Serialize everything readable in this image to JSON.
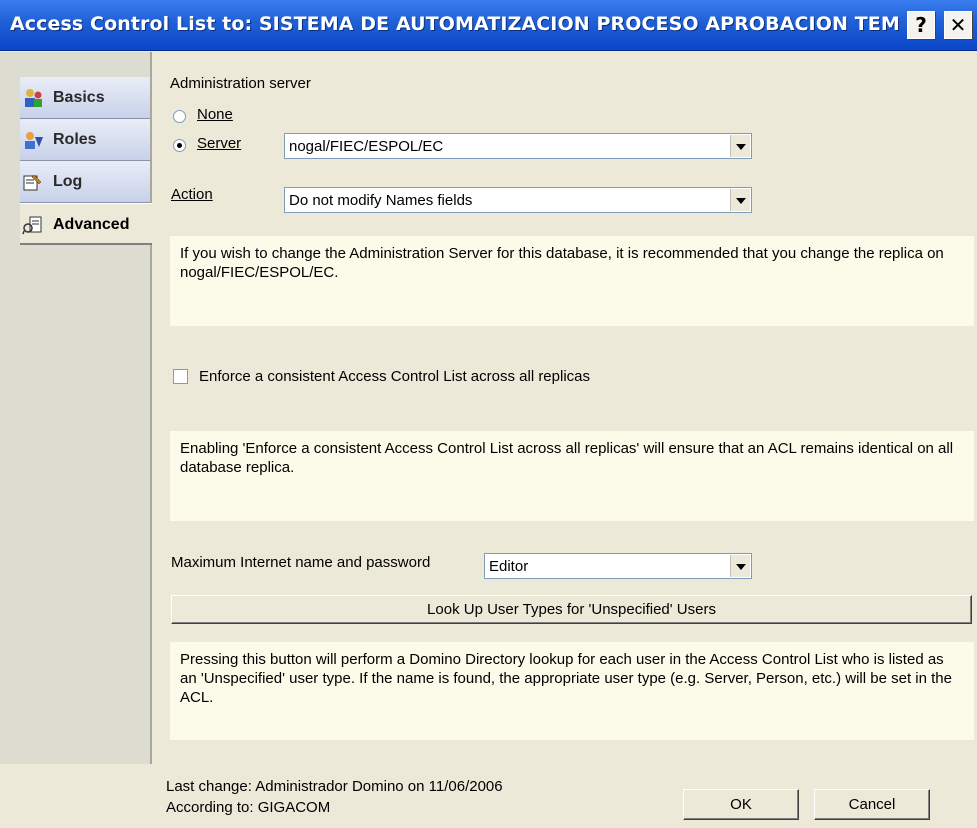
{
  "window": {
    "title": "Access Control List to: SISTEMA DE AUTOMATIZACION PROCESO APROBACION TEMAS DE TESIS",
    "help_label": "?",
    "close_label": "✕"
  },
  "sidebar": {
    "tabs": [
      {
        "label": "Basics",
        "icon": "people-icon"
      },
      {
        "label": "Roles",
        "icon": "roles-icon"
      },
      {
        "label": "Log",
        "icon": "log-icon"
      },
      {
        "label": "Advanced",
        "icon": "advanced-icon",
        "active": true
      }
    ]
  },
  "admin_server": {
    "heading": "Administration server",
    "option_none": "None",
    "option_server": "Server",
    "selected": "Server",
    "server_value": "nogal/FIEC/ESPOL/EC",
    "action_label": "Action",
    "action_value": "Do not modify Names fields",
    "info": "If you wish to change the Administration Server for this database, it is recommended that you change the replica on nogal/FIEC/ESPOL/EC."
  },
  "enforce": {
    "label": "Enforce a consistent Access Control List across all replicas",
    "checked": false,
    "info": "Enabling 'Enforce a consistent Access Control List across all replicas' will ensure that an ACL remains identical on all database replica."
  },
  "internet": {
    "label": "Maximum Internet name and password",
    "value": "Editor",
    "lookup_button": "Look Up User Types for 'Unspecified' Users",
    "info": "Pressing this button will perform a Domino Directory lookup for each user in the Access Control List who is listed as an 'Unspecified' user type.  If the name is found, the appropriate user type (e.g. Server, Person, etc.) will be set in the ACL."
  },
  "footer": {
    "last_change": "Last change: Administrador Domino on 11/06/2006",
    "according_to": "According to: GIGACOM",
    "ok_label": "OK",
    "cancel_label": "Cancel"
  }
}
